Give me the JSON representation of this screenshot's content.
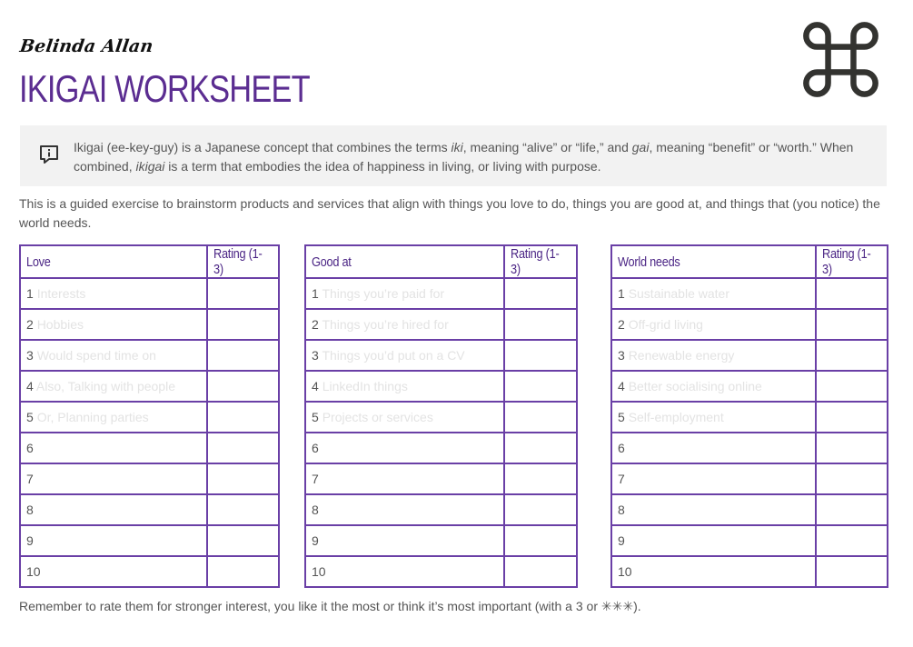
{
  "header": {
    "author": "Belinda Allan",
    "title": "IKIGAI WORKSHEET",
    "logo_icon": "command-key-icon"
  },
  "info": {
    "icon": "info-speech-bubble-icon",
    "text_parts": [
      {
        "text": "Ikigai (ee-key-guy) is a Japanese concept that combines the terms ",
        "italic": false
      },
      {
        "text": "iki",
        "italic": true
      },
      {
        "text": ", meaning “alive” or “life,” and ",
        "italic": false
      },
      {
        "text": "gai",
        "italic": true
      },
      {
        "text": ", meaning “benefit” or “worth.” When combined, ",
        "italic": false
      },
      {
        "text": "ikigai",
        "italic": true
      },
      {
        "text": " is a term that embodies the idea of happiness in living, or living with purpose.",
        "italic": false
      }
    ]
  },
  "intro": "This is a guided exercise to brainstorm products and services that align with things you love to do, things you are good at, and things that (you notice) the world needs.",
  "tables": [
    {
      "id": "love",
      "header": "Love",
      "rating_header": "Rating (1-3)",
      "rows": [
        {
          "num": "1",
          "hint": "Interests",
          "rating": ""
        },
        {
          "num": "2",
          "hint": "Hobbies",
          "rating": ""
        },
        {
          "num": "3",
          "hint": "Would spend time on",
          "rating": ""
        },
        {
          "num": "4",
          "hint": "Also, Talking with people",
          "rating": ""
        },
        {
          "num": "5",
          "hint": "Or, Planning parties",
          "rating": ""
        },
        {
          "num": "6",
          "hint": "",
          "rating": ""
        },
        {
          "num": "7",
          "hint": "",
          "rating": ""
        },
        {
          "num": "8",
          "hint": "",
          "rating": ""
        },
        {
          "num": "9",
          "hint": "",
          "rating": ""
        },
        {
          "num": "10",
          "hint": "",
          "rating": ""
        }
      ]
    },
    {
      "id": "good",
      "header": "Good at",
      "rating_header": "Rating (1-3)",
      "rows": [
        {
          "num": "1",
          "hint": "Things you’re paid for",
          "rating": ""
        },
        {
          "num": "2",
          "hint": "Things you’re hired for",
          "rating": ""
        },
        {
          "num": "3",
          "hint": "Things you’d put on a CV",
          "rating": ""
        },
        {
          "num": "4",
          "hint": "LinkedIn things",
          "rating": ""
        },
        {
          "num": "5",
          "hint": "Projects or services",
          "rating": ""
        },
        {
          "num": "6",
          "hint": "",
          "rating": ""
        },
        {
          "num": "7",
          "hint": "",
          "rating": ""
        },
        {
          "num": "8",
          "hint": "",
          "rating": ""
        },
        {
          "num": "9",
          "hint": "",
          "rating": ""
        },
        {
          "num": "10",
          "hint": "",
          "rating": ""
        }
      ]
    },
    {
      "id": "world",
      "header": "World needs",
      "rating_header": "Rating (1-3)",
      "rows": [
        {
          "num": "1",
          "hint": "Sustainable water",
          "rating": ""
        },
        {
          "num": "2",
          "hint": "Off-grid living",
          "rating": ""
        },
        {
          "num": "3",
          "hint": "Renewable energy",
          "rating": ""
        },
        {
          "num": "4",
          "hint": "Better socialising online",
          "rating": ""
        },
        {
          "num": "5",
          "hint": "Self-employment",
          "rating": ""
        },
        {
          "num": "6",
          "hint": "",
          "rating": ""
        },
        {
          "num": "7",
          "hint": "",
          "rating": ""
        },
        {
          "num": "8",
          "hint": "",
          "rating": ""
        },
        {
          "num": "9",
          "hint": "",
          "rating": ""
        },
        {
          "num": "10",
          "hint": "",
          "rating": ""
        }
      ]
    }
  ],
  "footer": "Remember to rate them for stronger interest, you like it the most or think it’s most important (with a 3 or ✳✳✳).",
  "colors": {
    "accent": "#5b2d91",
    "table_border": "#6a3fa6",
    "info_bg": "#f2f2f2",
    "hint_text": "#e3e3e3",
    "body_text": "#555555"
  }
}
